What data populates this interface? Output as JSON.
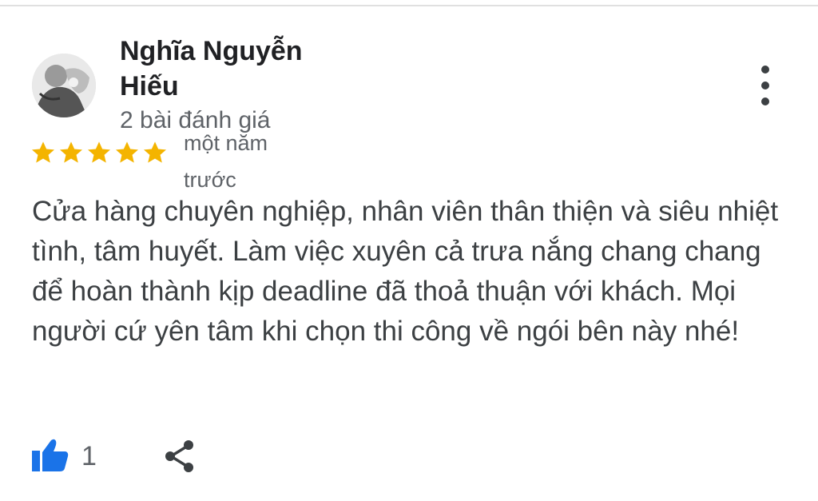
{
  "review": {
    "reviewer_name": "Nghĩa Nguyễn Hiếu",
    "review_count": "2 bài đánh giá",
    "rating": 5,
    "date": "một năm trước",
    "text": "Cửa hàng chuyên nghiệp, nhân viên thân thiện và siêu nhiệt tình, tâm huyết. Làm việc xuyên cả trưa nắng chang chang để hoàn thành kịp deadline đã thoả thuận với khách. Mọi người cứ yên tâm khi chọn thi công về ngói bên này nhé!",
    "likes": "1"
  },
  "icons": {
    "star": "star-icon",
    "more": "more-vert-icon",
    "like": "thumb-up-icon",
    "share": "share-icon"
  },
  "colors": {
    "star": "#F4B400",
    "like": "#1a73e8",
    "text": "#3c4043",
    "secondary_text": "#5f6368"
  }
}
